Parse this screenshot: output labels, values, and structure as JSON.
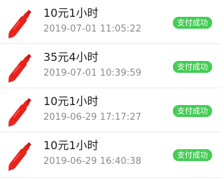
{
  "records": [
    {
      "icon": "red-pen-icon",
      "amount": "10元1小时",
      "time": "2019-07-01 11:05:22",
      "status": "支付成功"
    },
    {
      "icon": "red-pen-icon",
      "amount": "35元4小时",
      "time": "2019-07-01 10:39:59",
      "status": "支付成功"
    },
    {
      "icon": "red-pen-icon",
      "amount": "10元1小时",
      "time": "2019-06-29 17:17:27",
      "status": "支付成功"
    },
    {
      "icon": "red-pen-icon",
      "amount": "10元1小时",
      "time": "2019-06-29 16:40:38",
      "status": "支付成功"
    }
  ],
  "colors": {
    "pen_red": "#e8221b",
    "status_green": "#44cc55",
    "amount_text": "#1c1c1c",
    "time_text": "#8a8a8a"
  }
}
